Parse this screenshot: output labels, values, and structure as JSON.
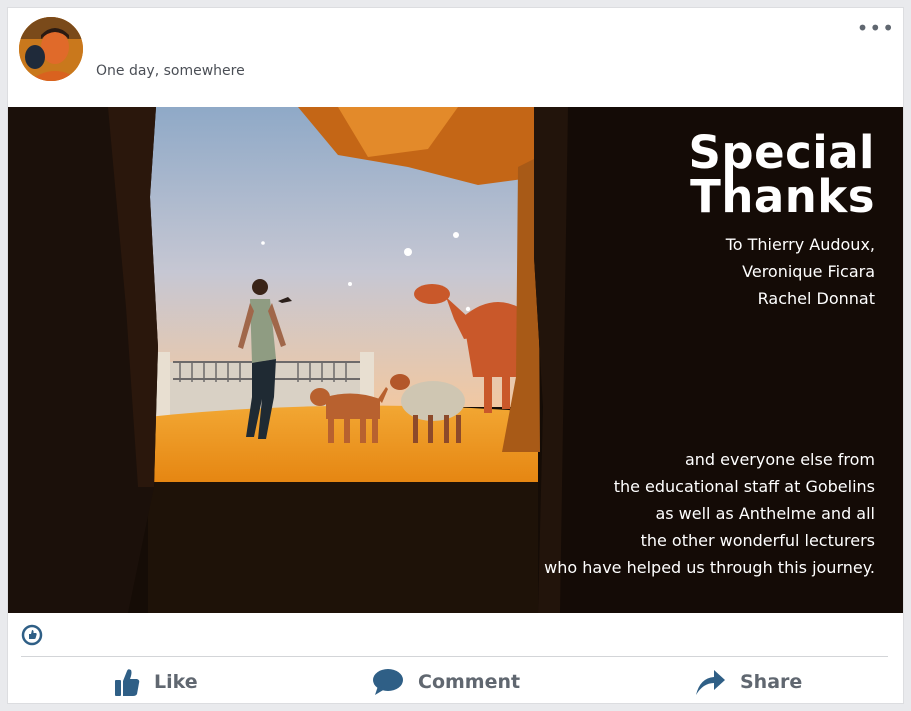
{
  "post": {
    "caption": "One day, somewhere",
    "menu_label": "•••"
  },
  "overlay": {
    "title_lines": [
      "Special",
      "Thanks"
    ],
    "names": [
      "To Thierry Audoux,",
      "Veronique Ficara",
      "Rachel Donnat"
    ],
    "closing": [
      "and everyone else from",
      "the educational staff at Gobelins",
      "as well as Anthelme and all",
      "the other wonderful lecturers",
      "who have helped us through this journey."
    ]
  },
  "actions": {
    "like_label": "Like",
    "comment_label": "Comment",
    "share_label": "Share"
  },
  "icons": {
    "reaction": "like-reaction-icon",
    "like": "thumbs-up-icon",
    "comment": "speech-bubble-icon",
    "share": "share-arrow-icon"
  },
  "colors": {
    "accent": "#2f5f86",
    "text_muted": "#606770"
  }
}
